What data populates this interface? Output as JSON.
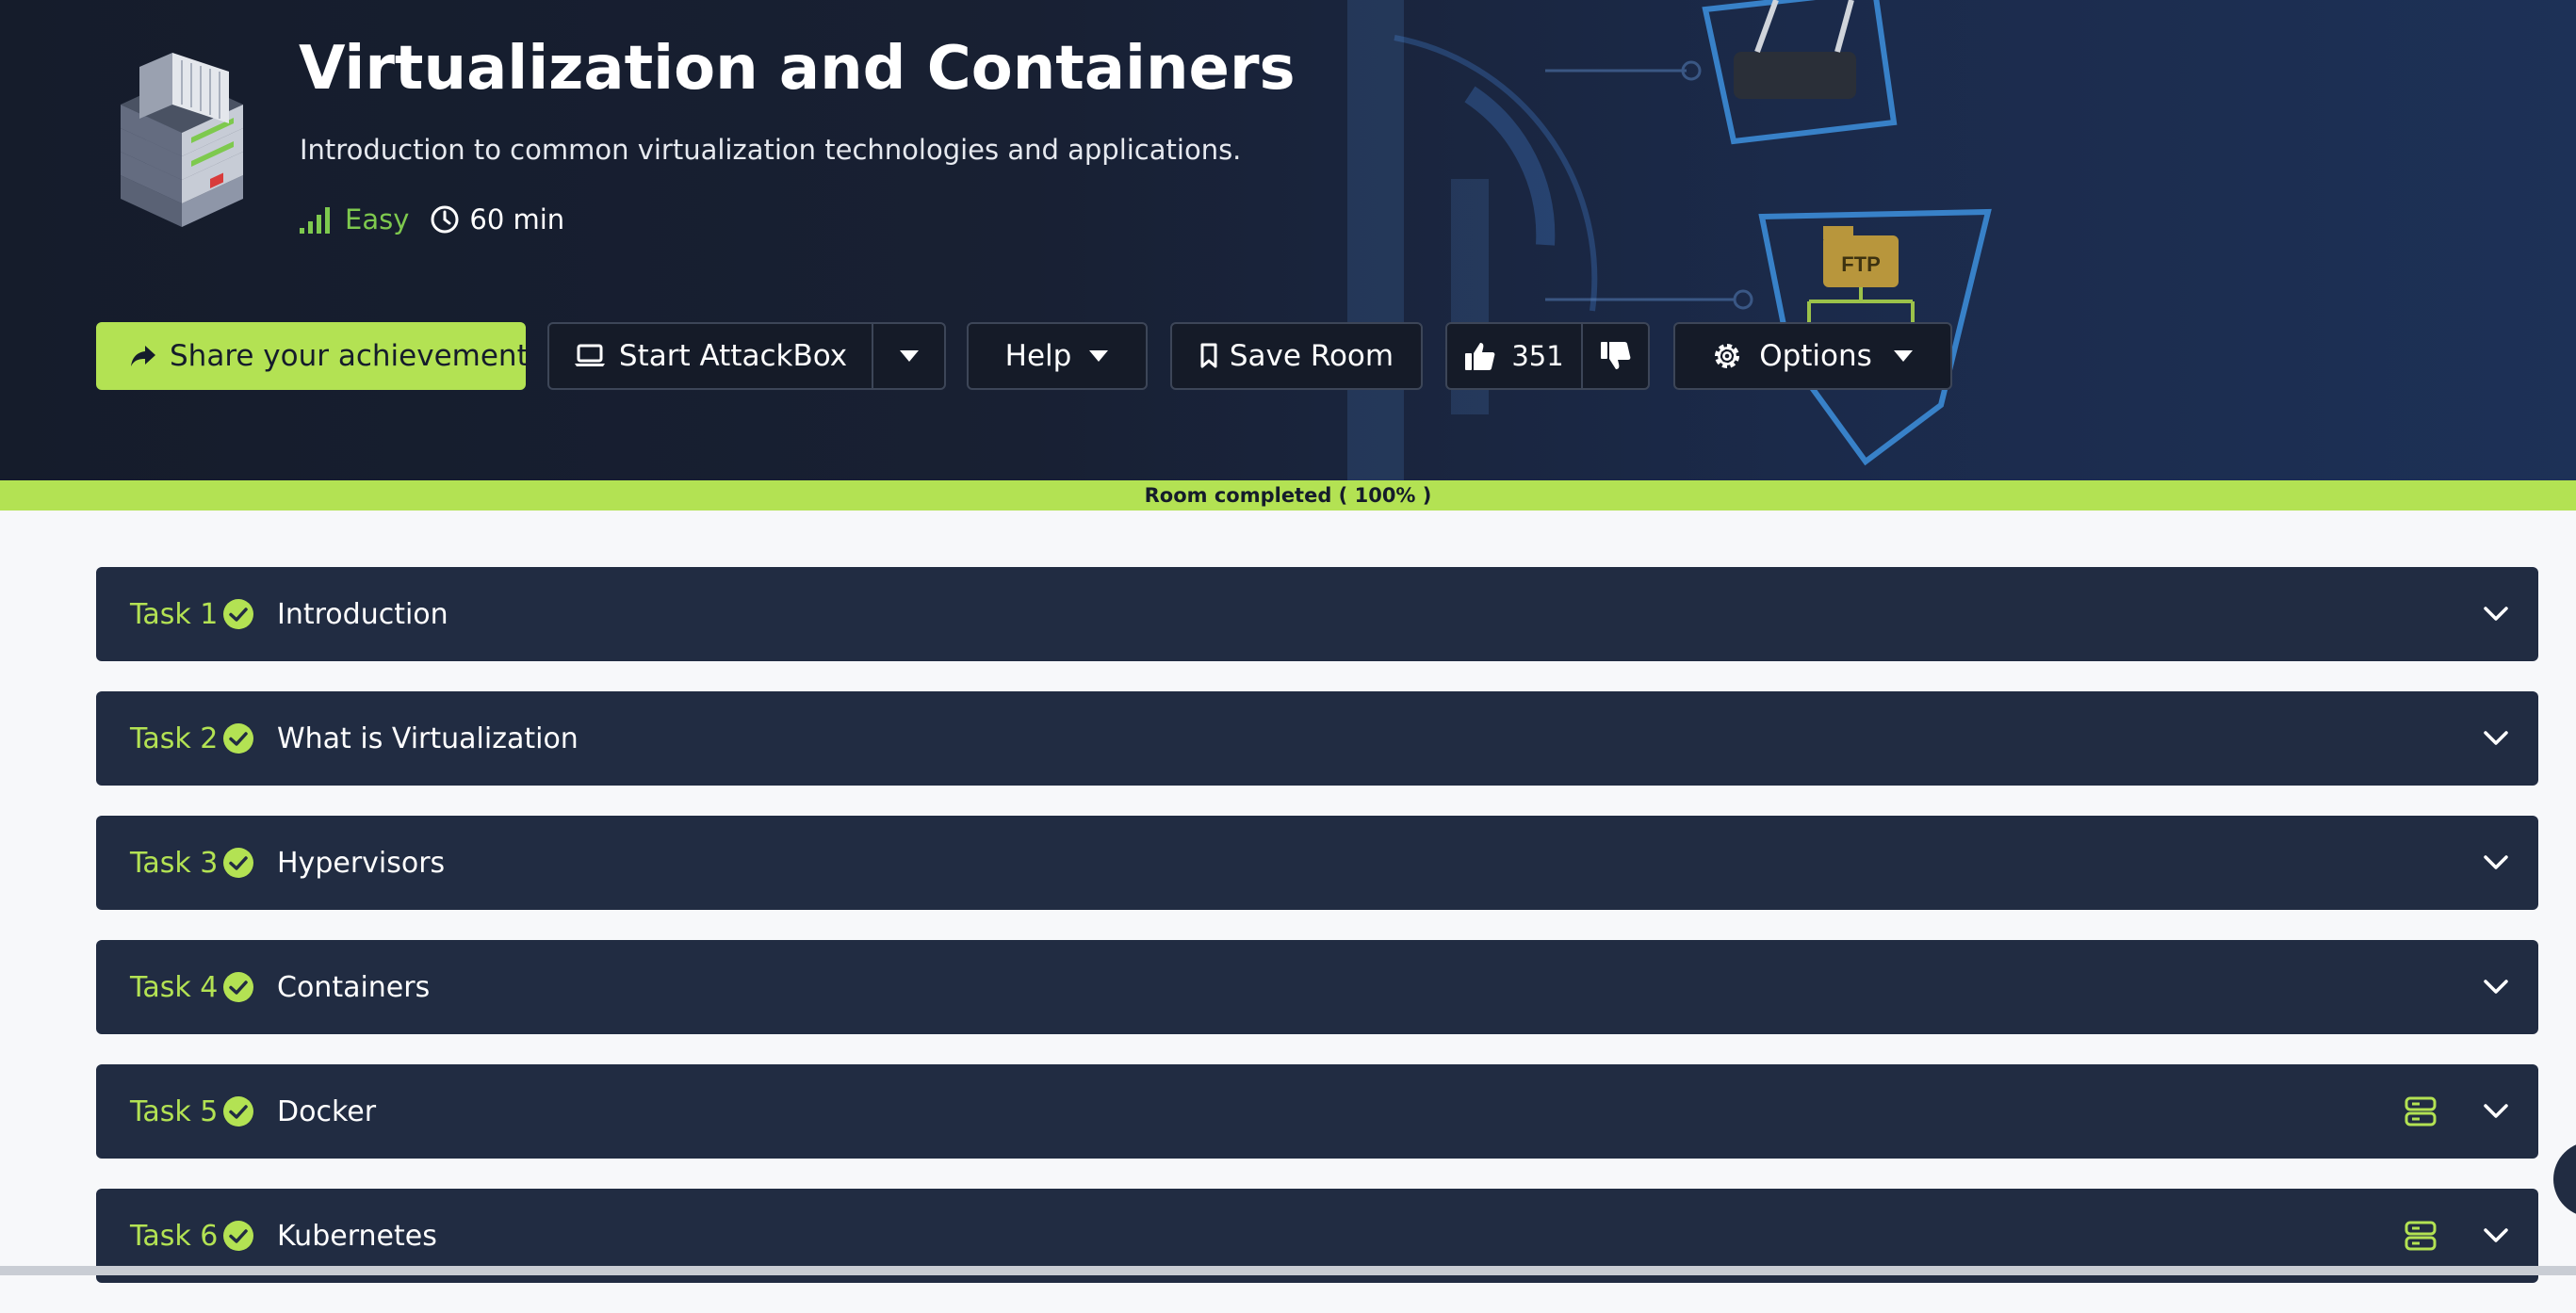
{
  "room": {
    "title": "Virtualization and Containers",
    "description": "Introduction to common virtualization technologies and applications.",
    "difficulty": "Easy",
    "duration": "60 min"
  },
  "hero_art": {
    "ftp_label": "FTP"
  },
  "actions": {
    "share_label": "Share your achievement",
    "attackbox_label": "Start AttackBox",
    "help_label": "Help",
    "save_label": "Save Room",
    "upvote_count": "351",
    "options_label": "Options"
  },
  "progress": {
    "label": "Room completed ( 100% )",
    "percent": 100
  },
  "tasks": [
    {
      "number": "Task 1",
      "name": "Introduction",
      "completed": true,
      "has_machine": false
    },
    {
      "number": "Task 2",
      "name": "What is Virtualization",
      "completed": true,
      "has_machine": false
    },
    {
      "number": "Task 3",
      "name": "Hypervisors",
      "completed": true,
      "has_machine": false
    },
    {
      "number": "Task 4",
      "name": "Containers",
      "completed": true,
      "has_machine": false
    },
    {
      "number": "Task 5",
      "name": "Docker",
      "completed": true,
      "has_machine": true
    },
    {
      "number": "Task 6",
      "name": "Kubernetes",
      "completed": true,
      "has_machine": true
    }
  ],
  "colors": {
    "accent": "#b3e253",
    "hero_background": "#151c2b",
    "task_background": "#212c42",
    "difficulty_easy": "#7ec94e",
    "page_background": "#f7f8fa"
  }
}
